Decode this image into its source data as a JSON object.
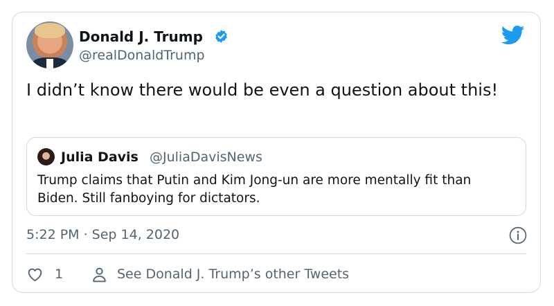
{
  "author": {
    "name": "Donald J. Trump",
    "handle": "@realDonaldTrump",
    "verified_icon": "verified-badge-icon",
    "avatar_icon": "avatar"
  },
  "tweet": {
    "text": "I didn’t know there would be even a question about this!",
    "timestamp": "5:22 PM · Sep 14, 2020",
    "likes": "1"
  },
  "quoted": {
    "name": "Julia Davis",
    "handle": "@JuliaDavisNews",
    "text": "Trump claims that Putin and Kim Jong-un are more mentally fit than Biden. Still fanboying for dictators."
  },
  "footer": {
    "other_tweets_label": "See Donald J. Trump’s other Tweets"
  },
  "colors": {
    "accent": "#1d9bf0",
    "secondary_text": "#536471",
    "border": "#cfd9de"
  },
  "icons": [
    "twitter-logo-icon",
    "info-icon",
    "heart-icon",
    "user-icon"
  ]
}
